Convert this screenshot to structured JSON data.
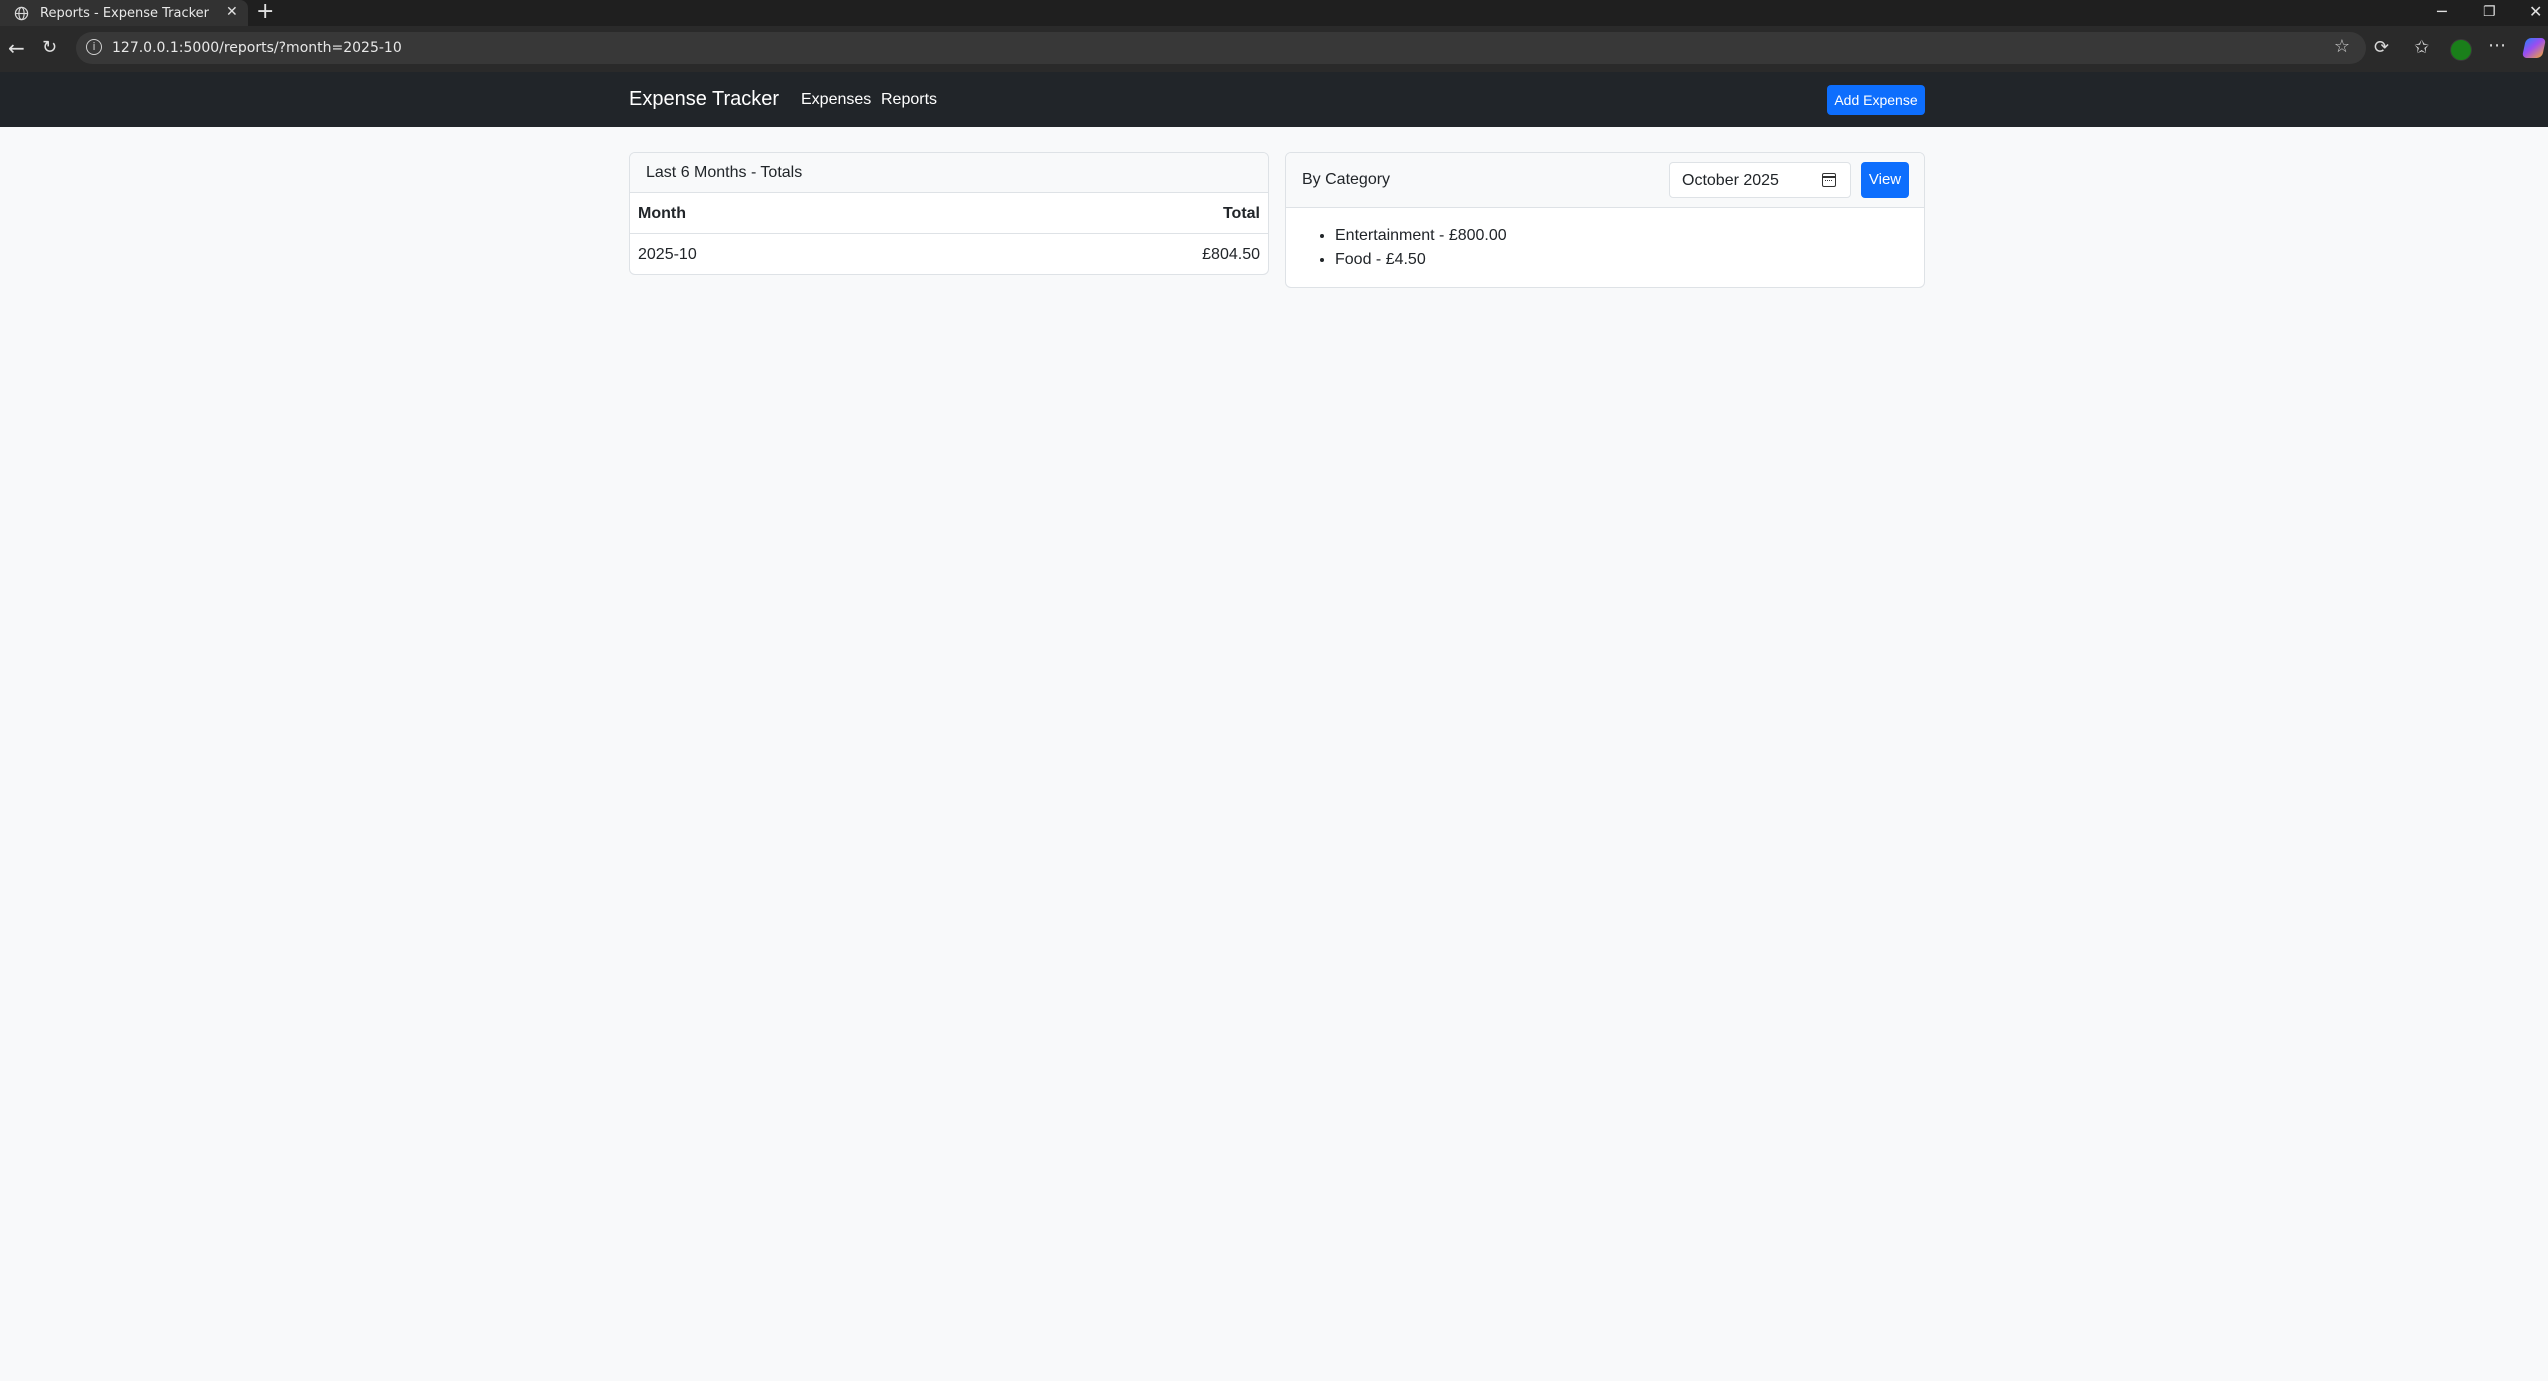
{
  "browser": {
    "tab_title": "Reports - Expense Tracker",
    "tab_close": "✕",
    "new_tab": "+",
    "url": "127.0.0.1:5000/reports/?month=2025-10",
    "window_controls": {
      "minimize": "─",
      "restore": "❐",
      "close": "✕"
    },
    "icons": [
      "back-icon",
      "reload-icon",
      "info-icon",
      "star-icon",
      "extensions-icon",
      "favorites-icon",
      "profile-avatar",
      "menu-icon",
      "copilot-icon"
    ]
  },
  "navbar": {
    "brand": "Expense Tracker",
    "links": [
      "Expenses",
      "Reports"
    ],
    "add_button": "Add Expense",
    "background": "#212529",
    "accent": "#0d6efd"
  },
  "totals_card": {
    "title": "Last 6 Months - Totals",
    "columns": [
      "Month",
      "Total"
    ],
    "rows": [
      {
        "month": "2025-10",
        "total": "£804.50"
      }
    ]
  },
  "category_card": {
    "title": "By Category",
    "month_value": "October 2025",
    "view_button": "View",
    "items": [
      "Entertainment - £800.00",
      "Food - £4.50"
    ]
  }
}
